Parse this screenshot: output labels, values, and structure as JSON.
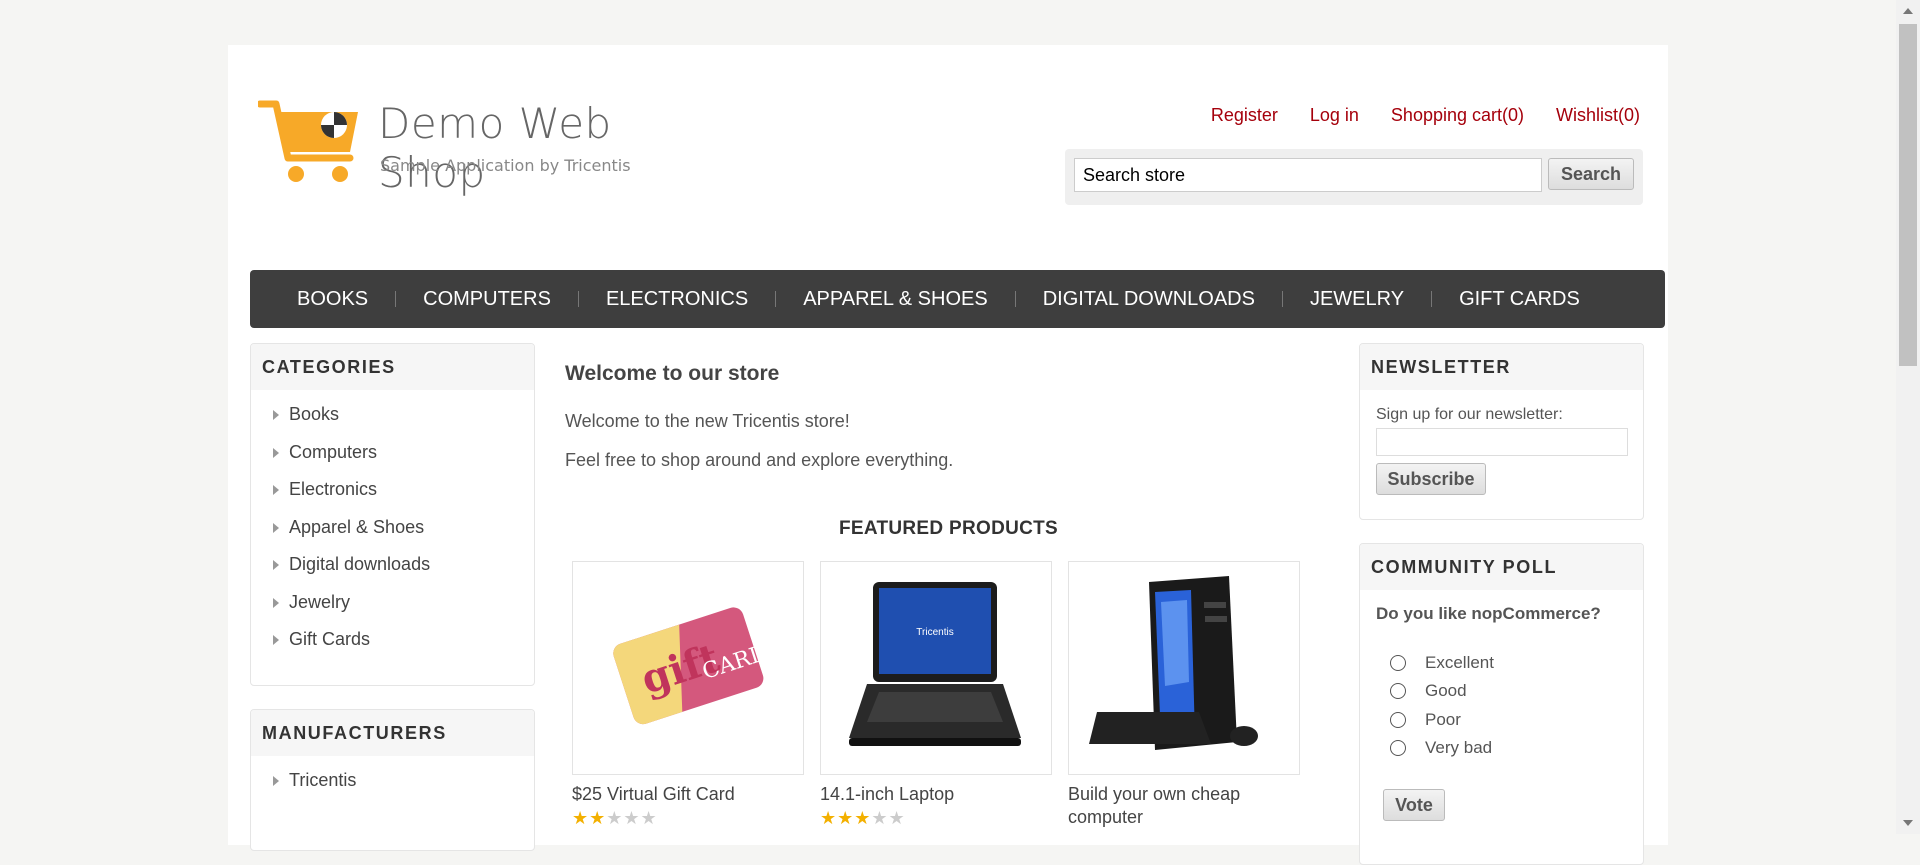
{
  "header": {
    "logo_title": "Demo Web Shop",
    "logo_subtitle": "Sample Application by Tricentis",
    "links": {
      "register": "Register",
      "login": "Log in",
      "cart": "Shopping cart(0)",
      "wishlist": "Wishlist(0)"
    },
    "search": {
      "value": "Search store",
      "button": "Search"
    }
  },
  "top_menu": [
    "BOOKS",
    "COMPUTERS",
    "ELECTRONICS",
    "APPAREL & SHOES",
    "DIGITAL DOWNLOADS",
    "JEWELRY",
    "GIFT CARDS"
  ],
  "categories": {
    "title": "CATEGORIES",
    "items": [
      "Books",
      "Computers",
      "Electronics",
      "Apparel & Shoes",
      "Digital downloads",
      "Jewelry",
      "Gift Cards"
    ]
  },
  "manufacturers": {
    "title": "MANUFACTURERS",
    "items": [
      "Tricentis"
    ]
  },
  "main": {
    "welcome_title": "Welcome to our store",
    "welcome_line1": "Welcome to the new Tricentis store!",
    "welcome_line2": "Feel free to shop around and explore everything.",
    "featured_title": "FEATURED PRODUCTS",
    "products": [
      {
        "name": "$25 Virtual Gift Card",
        "rating": 2,
        "image": "gift-card"
      },
      {
        "name": "14.1-inch Laptop",
        "rating": 3,
        "image": "laptop"
      },
      {
        "name": "Build your own cheap computer",
        "rating": 0,
        "image": "desktop-computer"
      }
    ]
  },
  "newsletter": {
    "title": "NEWSLETTER",
    "label": "Sign up for our newsletter:",
    "button": "Subscribe"
  },
  "poll": {
    "title": "COMMUNITY POLL",
    "question": "Do you like nopCommerce?",
    "options": [
      "Excellent",
      "Good",
      "Poor",
      "Very bad"
    ],
    "button": "Vote"
  },
  "colors": {
    "link": "#a5000b",
    "menu_bg": "#3e3e3e",
    "logo": "#f7a928",
    "star": "#f3b000"
  }
}
